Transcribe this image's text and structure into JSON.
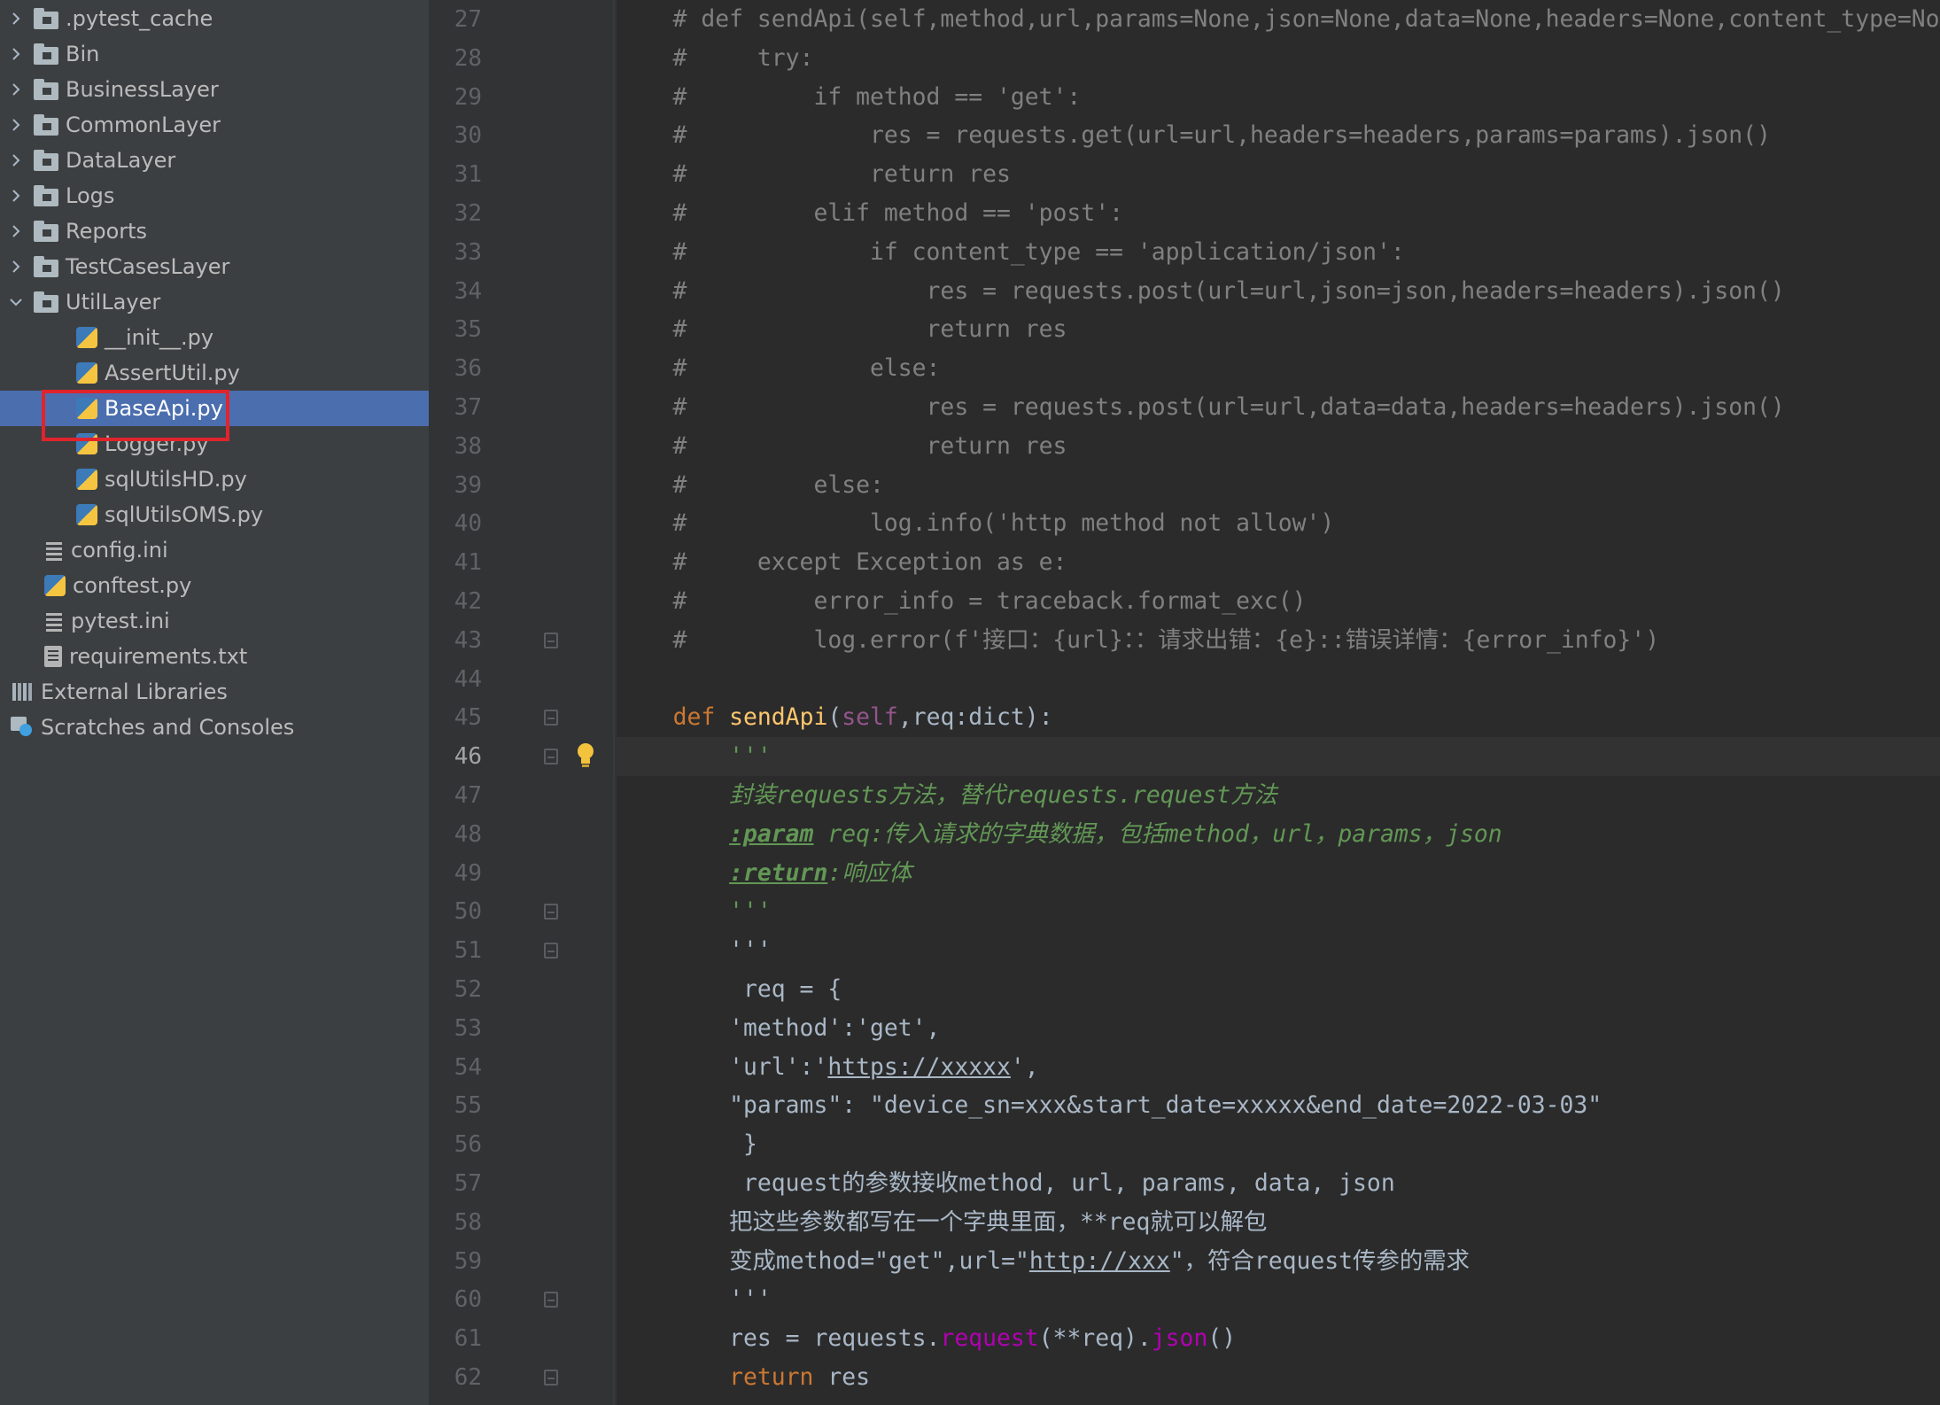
{
  "colors": {
    "sidebar_bg": "#3c3f41",
    "editor_bg": "#2b2b2b",
    "selection": "#4b6eaf",
    "highlight_box": "#e0242c",
    "comment": "#808080",
    "docstring": "#629755",
    "keyword": "#cc7832",
    "function_name": "#ffc66d"
  },
  "project_tree": [
    {
      "label": ".pytest_cache",
      "icon": "folder-icon",
      "expanded": false
    },
    {
      "label": "Bin",
      "icon": "folder-icon",
      "expanded": false
    },
    {
      "label": "BusinessLayer",
      "icon": "folder-icon",
      "expanded": false
    },
    {
      "label": "CommonLayer",
      "icon": "folder-icon",
      "expanded": false
    },
    {
      "label": "DataLayer",
      "icon": "folder-icon",
      "expanded": false
    },
    {
      "label": "Logs",
      "icon": "folder-icon",
      "expanded": false
    },
    {
      "label": "Reports",
      "icon": "folder-icon",
      "expanded": false
    },
    {
      "label": "TestCasesLayer",
      "icon": "folder-icon",
      "expanded": false
    },
    {
      "label": "UtilLayer",
      "icon": "folder-icon",
      "expanded": true
    },
    {
      "label": "__init__.py",
      "icon": "python-file-icon"
    },
    {
      "label": "AssertUtil.py",
      "icon": "python-file-icon"
    },
    {
      "label": "BaseApi.py",
      "icon": "python-file-icon",
      "selected": true
    },
    {
      "label": "Logger.py",
      "icon": "python-file-icon"
    },
    {
      "label": "sqlUtilsHD.py",
      "icon": "python-file-icon"
    },
    {
      "label": "sqlUtilsOMS.py",
      "icon": "python-file-icon"
    },
    {
      "label": "config.ini",
      "icon": "ini-file-icon"
    },
    {
      "label": "conftest.py",
      "icon": "python-file-icon"
    },
    {
      "label": "pytest.ini",
      "icon": "ini-file-icon"
    },
    {
      "label": "requirements.txt",
      "icon": "text-file-icon"
    },
    {
      "label": "External Libraries",
      "icon": "library-icon"
    },
    {
      "label": "Scratches and Consoles",
      "icon": "scratches-icon"
    }
  ],
  "editor": {
    "current_line": "46",
    "lines": [
      {
        "n": "27",
        "text": "    # def sendApi(self,method,url,params=None,json=None,data=None,headers=None,content_type=None):"
      },
      {
        "n": "28",
        "text": "    #     try:"
      },
      {
        "n": "29",
        "text": "    #         if method == 'get':"
      },
      {
        "n": "30",
        "text": "    #             res = requests.get(url=url,headers=headers,params=params).json()"
      },
      {
        "n": "31",
        "text": "    #             return res"
      },
      {
        "n": "32",
        "text": "    #         elif method == 'post':"
      },
      {
        "n": "33",
        "text": "    #             if content_type == 'application/json':"
      },
      {
        "n": "34",
        "text": "    #                 res = requests.post(url=url,json=json,headers=headers).json()"
      },
      {
        "n": "35",
        "text": "    #                 return res"
      },
      {
        "n": "36",
        "text": "    #             else:"
      },
      {
        "n": "37",
        "text": "    #                 res = requests.post(url=url,data=data,headers=headers).json()"
      },
      {
        "n": "38",
        "text": "    #                 return res"
      },
      {
        "n": "39",
        "text": "    #         else:"
      },
      {
        "n": "40",
        "text": "    #             log.info('http method not allow')"
      },
      {
        "n": "41",
        "text": "    #     except Exception as e:"
      },
      {
        "n": "42",
        "text": "    #         error_info = traceback.format_exc()"
      },
      {
        "n": "43",
        "text": "    #         log.error(f'接口：{url}：：请求出错：{e}::错误详情：{error_info}')"
      },
      {
        "n": "44",
        "text": ""
      },
      {
        "n": "45",
        "text": "    def sendApi(self,req:dict):"
      },
      {
        "n": "46",
        "text": "        '''"
      },
      {
        "n": "47",
        "text": "        封装requests方法，替代requests.request方法"
      },
      {
        "n": "48",
        "text": "        :param req:传入请求的字典数据，包括method，url，params，json"
      },
      {
        "n": "49",
        "text": "        :return:响应体"
      },
      {
        "n": "50",
        "text": "        '''"
      },
      {
        "n": "51",
        "text": "        '''"
      },
      {
        "n": "52",
        "text": "         req = {"
      },
      {
        "n": "53",
        "text": "        'method':'get',"
      },
      {
        "n": "54",
        "text": "        'url':'https://xxxxx',"
      },
      {
        "n": "55",
        "text": "        \"params\": \"device_sn=xxx&start_date=xxxxx&end_date=2022-03-03\""
      },
      {
        "n": "56",
        "text": "         }"
      },
      {
        "n": "57",
        "text": "         request的参数接收method, url, params, data, json"
      },
      {
        "n": "58",
        "text": "        把这些参数都写在一个字典里面，**req就可以解包"
      },
      {
        "n": "59",
        "text": "        变成method=\"get\",url=\"http://xxx\"，符合request传参的需求"
      },
      {
        "n": "60",
        "text": "        '''"
      },
      {
        "n": "61",
        "text": "        res = requests.request(**req).json()"
      },
      {
        "n": "62",
        "text": "        return res"
      }
    ]
  }
}
